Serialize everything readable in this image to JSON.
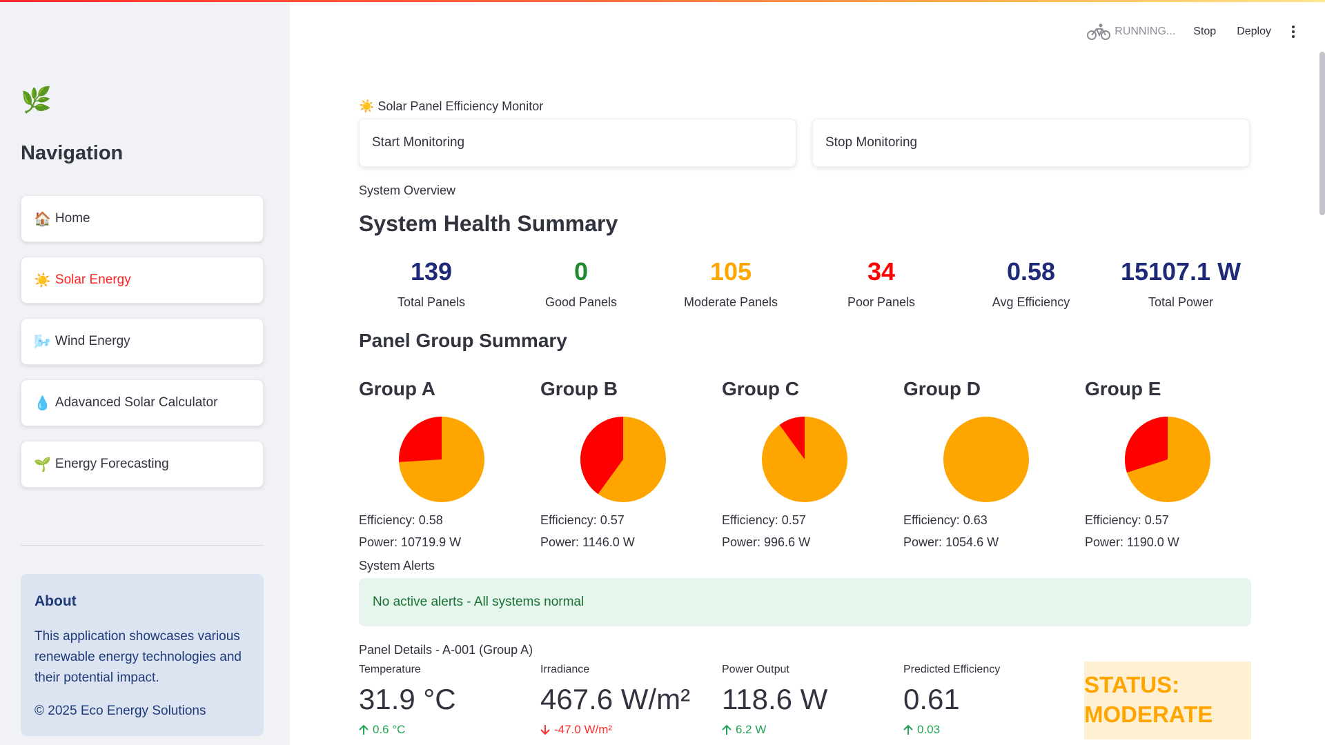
{
  "sidebar": {
    "logo_icon": "🌿",
    "title": "Navigation",
    "items": [
      {
        "icon": "🏠",
        "label": "Home"
      },
      {
        "icon": "☀️",
        "label": "Solar Energy",
        "active": true
      },
      {
        "icon": "🌬️",
        "label": "Wind Energy"
      },
      {
        "icon": "💧",
        "label": "Adavanced Solar Calculator"
      },
      {
        "icon": "🌱",
        "label": "Energy Forecasting"
      }
    ],
    "about": {
      "title": "About",
      "text": "This application showcases various renewable energy technologies and their potential impact.",
      "copyright": "© 2025 Eco Energy Solutions"
    }
  },
  "header": {
    "status": "RUNNING...",
    "stop_label": "Stop",
    "deploy_label": "Deploy"
  },
  "main": {
    "monitor_title": "☀️ Solar Panel Efficiency Monitor",
    "start_button": "Start Monitoring",
    "stop_button": "Stop Monitoring",
    "overview_caption": "System Overview",
    "health_title": "System Health Summary",
    "metrics": [
      {
        "value": "139",
        "label": "Total Panels",
        "color": "#1e2a78"
      },
      {
        "value": "0",
        "label": "Good Panels",
        "color": "#1e8a2e"
      },
      {
        "value": "105",
        "label": "Moderate Panels",
        "color": "#ffa500"
      },
      {
        "value": "34",
        "label": "Poor Panels",
        "color": "#ff0000"
      },
      {
        "value": "0.58",
        "label": "Avg Efficiency",
        "color": "#1e2a78"
      },
      {
        "value": "15107.1 W",
        "label": "Total Power",
        "color": "#1e2a78"
      }
    ],
    "group_summary_title": "Panel Group Summary",
    "groups": [
      {
        "name": "Group A",
        "efficiency": "Efficiency: 0.58",
        "power": "Power: 10719.9 W",
        "poor_fraction": 0.26
      },
      {
        "name": "Group B",
        "efficiency": "Efficiency: 0.57",
        "power": "Power: 1146.0 W",
        "poor_fraction": 0.4
      },
      {
        "name": "Group C",
        "efficiency": "Efficiency: 0.57",
        "power": "Power: 996.6 W",
        "poor_fraction": 0.1
      },
      {
        "name": "Group D",
        "efficiency": "Efficiency: 0.63",
        "power": "Power: 1054.6 W",
        "poor_fraction": 0.0
      },
      {
        "name": "Group E",
        "efficiency": "Efficiency: 0.57",
        "power": "Power: 1190.0 W",
        "poor_fraction": 0.3
      }
    ],
    "pie_colors": {
      "moderate": "#ffa500",
      "poor": "#ff0000"
    },
    "alerts_caption": "System Alerts",
    "alert_text": "No active alerts - All systems normal",
    "details_caption": "Panel Details - A-001 (Group A)",
    "details": [
      {
        "label": "Temperature",
        "value": "31.9 °C",
        "delta": "0.6 °C",
        "direction": "up"
      },
      {
        "label": "Irradiance",
        "value": "467.6 W/m²",
        "delta": "-47.0 W/m²",
        "direction": "down"
      },
      {
        "label": "Power Output",
        "value": "118.6 W",
        "delta": "6.2 W",
        "direction": "up"
      },
      {
        "label": "Predicted Efficiency",
        "value": "0.61",
        "delta": "0.03",
        "direction": "up"
      }
    ],
    "status_line1": "STATUS:",
    "status_line2": "MODERATE"
  }
}
